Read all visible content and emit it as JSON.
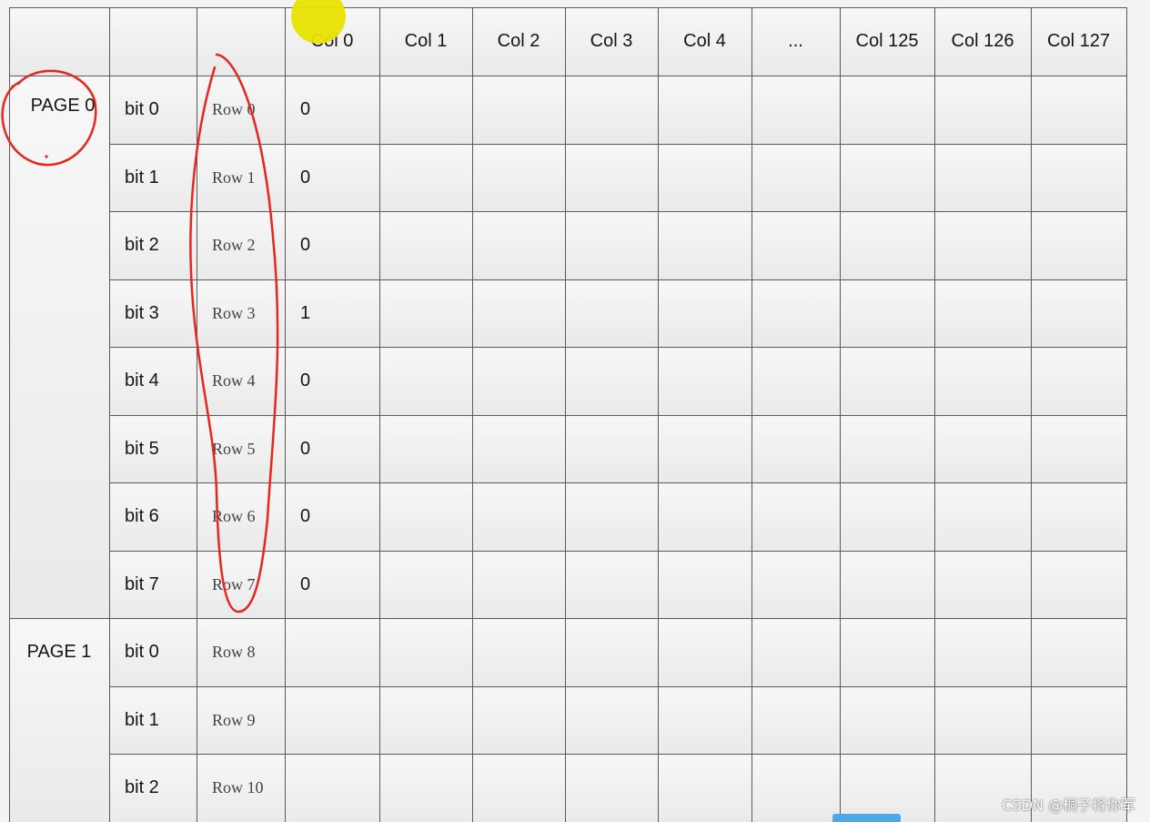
{
  "table": {
    "columns": [
      "",
      "",
      "",
      "Col 0",
      "Col 1",
      "Col 2",
      "Col 3",
      "Col 4",
      "...",
      "Col 125",
      "Col 126",
      "Col 127"
    ],
    "pages": [
      {
        "label": "PAGE 0",
        "rows": [
          {
            "bit": "bit 0",
            "row": "Row 0",
            "col0": "0"
          },
          {
            "bit": "bit 1",
            "row": "Row 1",
            "col0": "0"
          },
          {
            "bit": "bit 2",
            "row": "Row 2",
            "col0": "0"
          },
          {
            "bit": "bit 3",
            "row": "Row 3",
            "col0": "1"
          },
          {
            "bit": "bit 4",
            "row": "Row 4",
            "col0": "0"
          },
          {
            "bit": "bit 5",
            "row": "Row 5",
            "col0": "0"
          },
          {
            "bit": "bit 6",
            "row": "Row 6",
            "col0": "0"
          },
          {
            "bit": "bit 7",
            "row": "Row 7",
            "col0": "0"
          }
        ]
      },
      {
        "label": "PAGE 1",
        "rows": [
          {
            "bit": "bit 0",
            "row": "Row 8",
            "col0": ""
          },
          {
            "bit": "bit 1",
            "row": "Row 9",
            "col0": ""
          },
          {
            "bit": "bit 2",
            "row": "Row 10",
            "col0": ""
          }
        ]
      }
    ]
  },
  "annotations": {
    "highlight_color": "#e9e200",
    "pen_color": "#e8261b"
  },
  "watermark": "CSDN @桐子将你军"
}
